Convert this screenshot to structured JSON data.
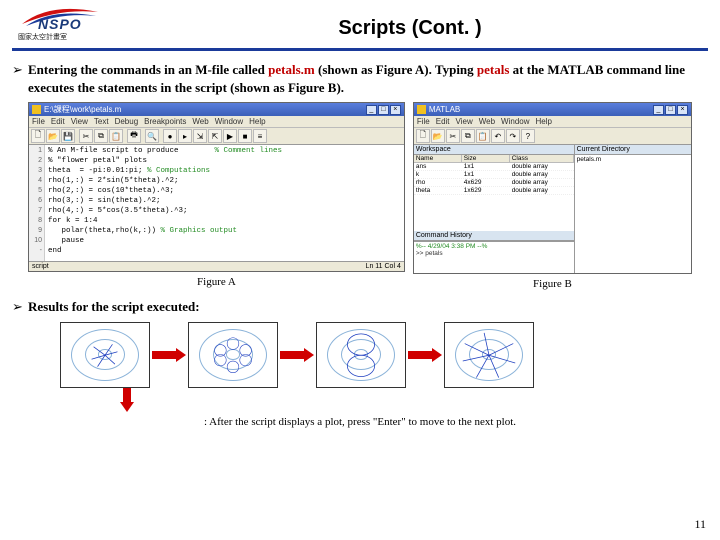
{
  "header": {
    "logo_text": "NSPO",
    "logo_sub": "國家太空計畫室",
    "title": "Scripts (Cont. )"
  },
  "bullet1": {
    "sym": "➢",
    "t1": "Entering the commands in an M-file called ",
    "red1": "petals.m",
    "t2": " (shown as Figure A). Typing ",
    "red2": "petals",
    "t3": " at the MATLAB command line executes the statements in the script (shown as Figure B)."
  },
  "figA": {
    "title": "E:\\課程\\work\\petals.m",
    "menus": [
      "File",
      "Edit",
      "View",
      "Text",
      "Debug",
      "Breakpoints",
      "Web",
      "Window",
      "Help"
    ],
    "gutter": [
      "1",
      "2",
      "3",
      "4",
      "5",
      "6",
      "7",
      "8",
      "9",
      "10",
      "-"
    ],
    "code_lines": [
      {
        "c": "% An M-file script to produce       ",
        "com": " % Comment lines"
      },
      {
        "c": "% \"flower petal\" plots",
        "com": ""
      },
      {
        "c": "theta  = -pi:0.01:pi;",
        "com": " % Computations"
      },
      {
        "c": "rho(1,:) = 2*sin(5*theta).^2;",
        "com": ""
      },
      {
        "c": "rho(2,:) = cos(10*theta).^3;",
        "com": ""
      },
      {
        "c": "rho(3,:) = sin(theta).^2;",
        "com": ""
      },
      {
        "c": "rho(4,:) = 5*cos(3.5*theta).^3;",
        "com": ""
      },
      {
        "c": "for k = 1:4",
        "com": ""
      },
      {
        "c": "   polar(theta,rho(k,:))",
        "com": " % Graphics output"
      },
      {
        "c": "   pause",
        "com": ""
      },
      {
        "c": "end",
        "com": ""
      }
    ],
    "status_l": "script",
    "status_r": "Ln 11   Col 4",
    "caption": "Figure A"
  },
  "figB": {
    "title": "MATLAB",
    "menus": [
      "File",
      "Edit",
      "View",
      "Web",
      "Window",
      "Help"
    ],
    "ws_title": "Workspace",
    "ws_cols": [
      "Name",
      "Size",
      "Class"
    ],
    "ws_rows": [
      [
        "ans",
        "1x1",
        "double array"
      ],
      [
        "k",
        "1x1",
        "double array"
      ],
      [
        "rho",
        "4x629",
        "double array"
      ],
      [
        "theta",
        "1x629",
        "double array"
      ]
    ],
    "hist_title": "Command History",
    "hist_line": "%-- 4/29/04  3:38 PM --%",
    "curdir_title": "Current Directory",
    "curdir_item": "petals.m",
    "cmd_line": ">> petals",
    "caption": "Figure B"
  },
  "bullet2": {
    "sym": "➢",
    "text": "Results for the script executed:"
  },
  "footnote": {
    "t1": ": After the script displays a plot, press \"Enter\" to move to the next plot."
  },
  "pagenum": "11"
}
